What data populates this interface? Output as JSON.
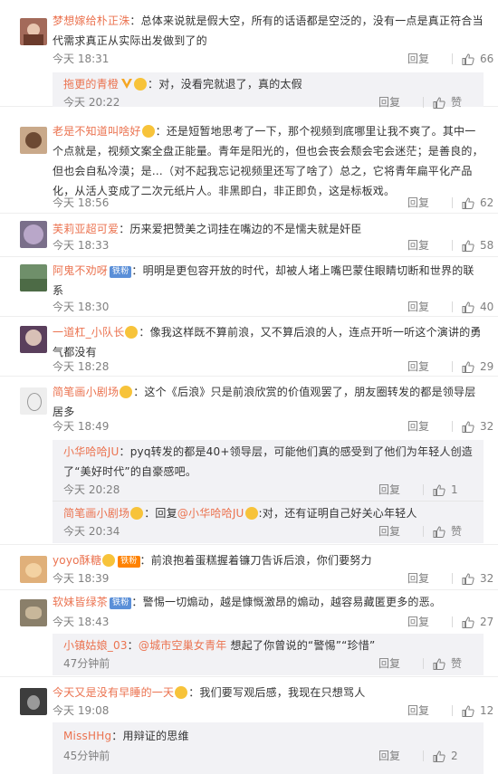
{
  "ui": {
    "reply_label": "回复",
    "like_label": "赞"
  },
  "comments": [
    {
      "user": "梦想嫁给朴正洙",
      "sep": "：",
      "text": "总体来说就是假大空，所有的话语都是空泛的，没有一点是真正符合当代需求真正从实际出发做到了的",
      "time": "今天 18:31",
      "likes": "66",
      "replies": [
        {
          "user": "拖更的青橙",
          "badge": "",
          "text": "：对，没看完就退了，真的太假",
          "time": "今天 20:22",
          "likes": "赞"
        }
      ]
    },
    {
      "user": "老是不知道叫啥好",
      "sep": "：",
      "text": "还是短暂地思考了一下，那个视频到底哪里让我不爽了。其中一个点就是，视频文案全盘正能量。青年是阳光的，但也会丧会颓会宅会迷茫；是善良的，但也会自私冷漠；是…（对不起我忘记视频里还写了啥了）总之，它将青年扁平化产品化，从活人变成了二次元纸片人。非黑即白，非正即负，这是标板戏。",
      "time": "今天 18:56",
      "likes": "62",
      "replies": []
    },
    {
      "user": "芙莉亚超可爱",
      "sep": "：",
      "text": "历来爱把赞美之词挂在嘴边的不是懦夫就是奸臣",
      "time": "今天 18:33",
      "likes": "58",
      "replies": []
    },
    {
      "user": "阿鬼不劝呀",
      "badge": "铁粉",
      "sep": "：",
      "text": "明明是更包容开放的时代，却被人堵上嘴巴蒙住眼睛切断和世界的联系",
      "time": "今天 18:30",
      "likes": "40",
      "replies": []
    },
    {
      "user": "一道杠_小队长",
      "sep": "：",
      "text": "像我这样既不算前浪，又不算后浪的人，连点开听一听这个演讲的勇气都没有",
      "time": "今天 18:28",
      "likes": "29",
      "replies": []
    },
    {
      "user": "简笔画小剧场",
      "sep": "：",
      "text": "这个《后浪》只是前浪欣赏的价值观罢了，朋友圈转发的都是领导层居多",
      "time": "今天 18:49",
      "likes": "32",
      "replies": [
        {
          "user": "小华哈哈JU",
          "text": "：pyq转发的都是40+领导层，可能他们真的感受到了他们为年轻人创造了“美好时代”的自豪感吧。",
          "time": "今天 20:28",
          "likes": "1"
        },
        {
          "user": "简笔画小剧场",
          "text_pre": "：回复",
          "mention": "@小华哈哈JU",
          "text_post": ":对，还有证明自己好关心年轻人",
          "time": "今天 20:34",
          "likes": "赞"
        }
      ]
    },
    {
      "user": "yoyo酥糖",
      "badge": "铁粉",
      "sep": "：",
      "text": "前浪抱着蛋糕握着镰刀告诉后浪，你们要努力",
      "time": "今天 18:39",
      "likes": "32",
      "replies": []
    },
    {
      "user": "软妹皆绿茶",
      "badge": "铁粉",
      "sep": "：",
      "text": "警惕一切煽动，越是慷慨激昂的煽动，越容易藏匿更多的恶。",
      "time": "今天 18:43",
      "likes": "27",
      "replies": [
        {
          "user": "小镇姑娘_03",
          "text_pre": "：",
          "mention": "@城市空巢女青年",
          "text_post": " 想起了你曾说的“警惕”“珍惜”",
          "time": "47分钟前",
          "likes": "赞"
        }
      ]
    },
    {
      "user": "今天又是没有早睡的一天",
      "sep": "：",
      "text": "我们要写观后感，我现在只想骂人",
      "time": "今天 19:08",
      "likes": "12",
      "replies": [
        {
          "user": "MissHHg",
          "text": "：用辩证的思维",
          "time": "45分钟前",
          "likes": "2"
        }
      ]
    }
  ],
  "colors": {
    "username": "#eb7350",
    "meta": "#808080",
    "sub_bg": "#f2f2f5"
  }
}
